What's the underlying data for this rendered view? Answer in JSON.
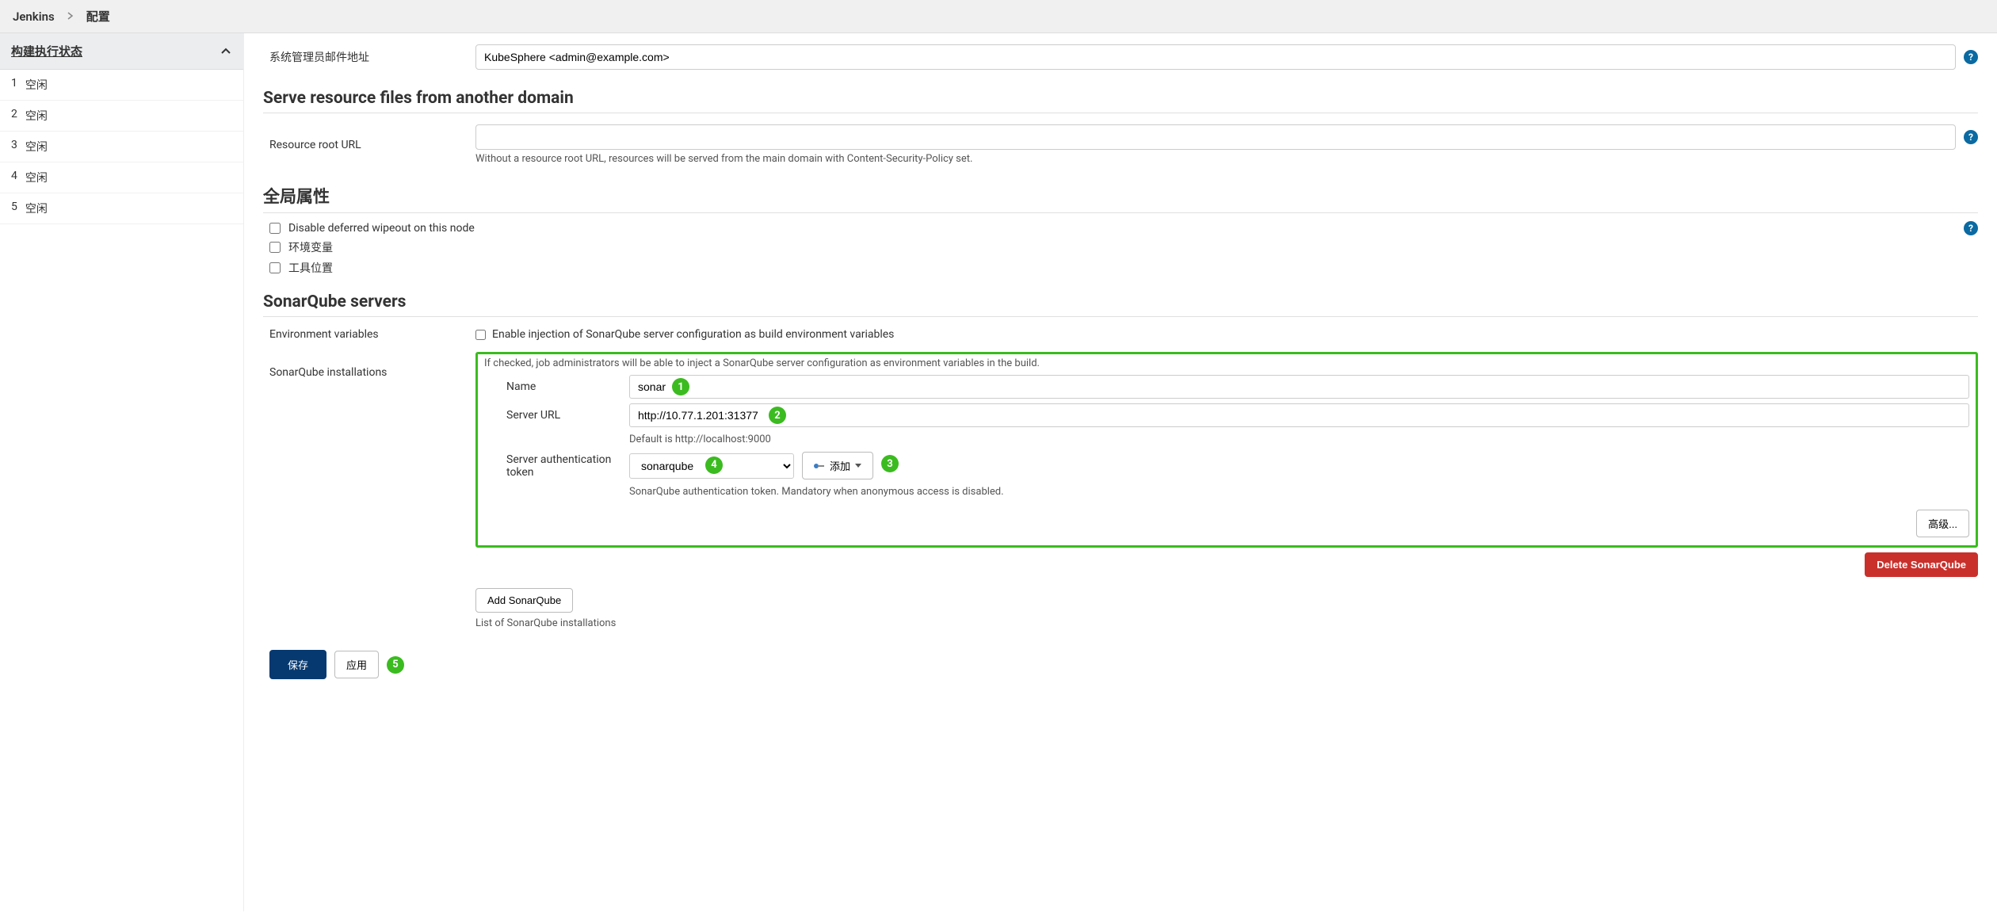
{
  "breadcrumb": {
    "root": "Jenkins",
    "current": "配置"
  },
  "sidebar": {
    "title": "构建执行状态",
    "items": [
      {
        "num": "1",
        "label": "空闲"
      },
      {
        "num": "2",
        "label": "空闲"
      },
      {
        "num": "3",
        "label": "空闲"
      },
      {
        "num": "4",
        "label": "空闲"
      },
      {
        "num": "5",
        "label": "空闲"
      }
    ]
  },
  "admin_email": {
    "label": "系统管理员邮件地址",
    "value": "KubeSphere <admin@example.com>"
  },
  "serve_resource": {
    "heading": "Serve resource files from another domain",
    "label": "Resource root URL",
    "value": "",
    "hint": "Without a resource root URL, resources will be served from the main domain with Content-Security-Policy set."
  },
  "global_props": {
    "heading": "全局属性",
    "opts": [
      "Disable deferred wipeout on this node",
      "环境变量",
      "工具位置"
    ]
  },
  "sonar": {
    "heading": "SonarQube servers",
    "env_label": "Environment variables",
    "env_checkbox": "Enable injection of SonarQube server configuration as build environment variables",
    "install_label": "SonarQube installations",
    "hint_top": "If checked, job administrators will be able to inject a SonarQube server configuration as environment variables in the build.",
    "name_label": "Name",
    "name_value": "sonar",
    "url_label": "Server URL",
    "url_value": "http://10.77.1.201:31377",
    "url_hint": "Default is http://localhost:9000",
    "token_label": "Server authentication token",
    "token_value": "sonarqube",
    "token_hint": "SonarQube authentication token. Mandatory when anonymous access is disabled.",
    "add_btn": "添加",
    "advanced_btn": "高级...",
    "delete_btn": "Delete SonarQube",
    "add_sonar_btn": "Add SonarQube",
    "list_hint": "List of SonarQube installations"
  },
  "footer": {
    "save": "保存",
    "apply": "应用"
  },
  "callouts": {
    "c1": "1",
    "c2": "2",
    "c3": "3",
    "c4": "4",
    "c5": "5"
  }
}
